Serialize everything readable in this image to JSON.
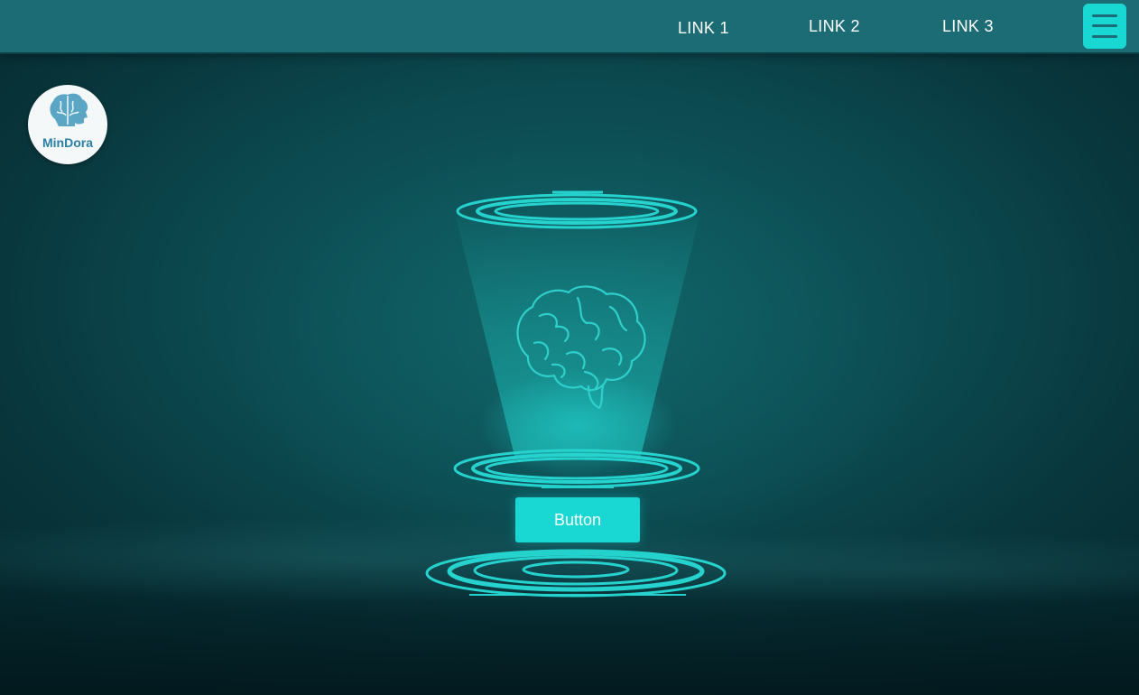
{
  "nav": {
    "links": [
      "LINK 1",
      "LINK 2",
      "LINK 3"
    ],
    "menu_icon": "hamburger-menu-icon"
  },
  "logo": {
    "text": "MinDora",
    "icon": "brain-head-icon"
  },
  "hero": {
    "illustration": "brain-hologram-icon",
    "button_label": "Button"
  },
  "colors": {
    "navbar": "#1b6c74",
    "accent": "#19d7d3",
    "background": "#0b4a50",
    "logo_text": "#2a7fa4"
  }
}
